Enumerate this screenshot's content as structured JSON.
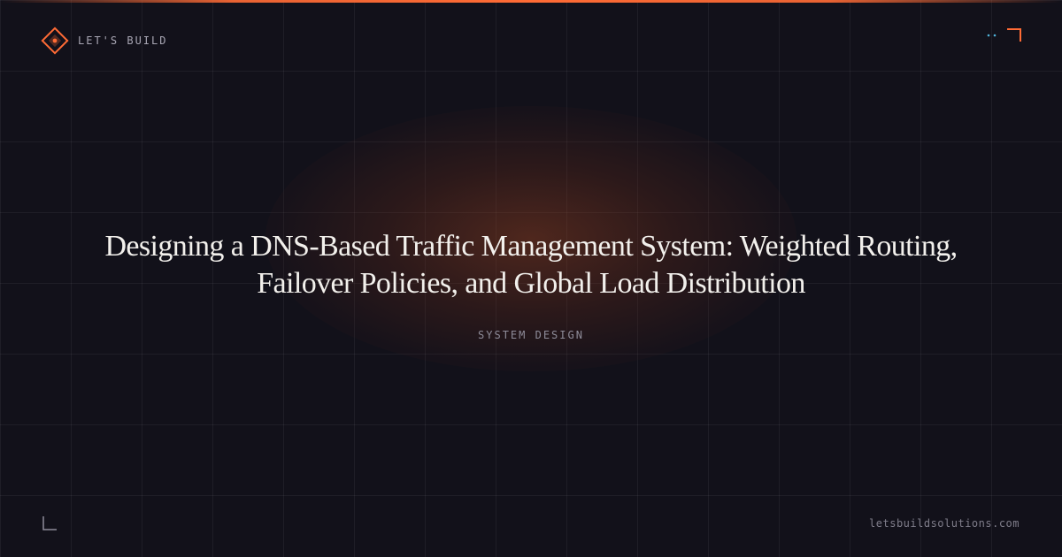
{
  "brand": {
    "name": "LET'S BUILD",
    "logo_icon": "diamond-logo-icon"
  },
  "article": {
    "title": "Designing a DNS-Based Traffic Management System: Weighted Routing, Failover Policies, and Global Load Distribution",
    "category": "SYSTEM DESIGN"
  },
  "footer": {
    "site_url": "letsbuildsolutions.com"
  },
  "decor": {
    "top_right": "corner-bracket-icon",
    "bottom_left": "corner-bracket-icon"
  },
  "colors": {
    "background": "#12111a",
    "accent": "#ff6b35",
    "accent_secondary": "#4fb3d9",
    "text_primary": "#f2f0ec",
    "text_muted": "#8e8c99"
  }
}
